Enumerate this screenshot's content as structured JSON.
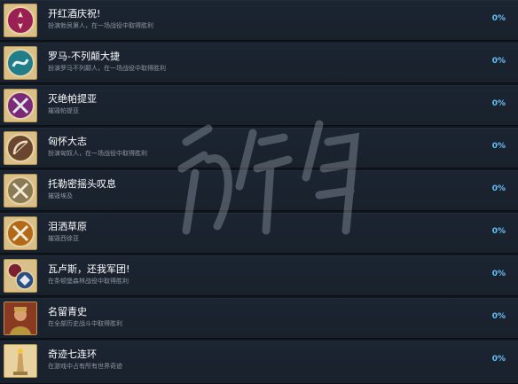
{
  "achievements": [
    {
      "title": "开红酒庆祝!",
      "desc": "扮演勃艮第人，在一场战役中取得胜利",
      "percent": "0%",
      "icon": "burgundian-tree-icon",
      "color": "#9a1f55"
    },
    {
      "title": "罗马-不列颠大捷",
      "desc": "扮演罗马不列颠人，在一场战役中取得胜利",
      "percent": "0%",
      "icon": "romano-british-dragon-icon",
      "color": "#1f7e8a"
    },
    {
      "title": "灭绝帕提亚",
      "desc": "摧毁帕提亚",
      "percent": "0%",
      "icon": "crossed-swords-icon",
      "color": "#7a2a7a"
    },
    {
      "title": "匈怀大志",
      "desc": "扮演匈奴人，在一场战役中取得胜利",
      "percent": "0%",
      "icon": "hun-bow-icon",
      "color": "#6a4530"
    },
    {
      "title": "托勒密摇头叹息",
      "desc": "摧毁埃及",
      "percent": "0%",
      "icon": "crossed-swords-icon",
      "color": "#8a7a55"
    },
    {
      "title": "泪洒草原",
      "desc": "摧毁西徐亚",
      "percent": "0%",
      "icon": "crossed-swords-icon",
      "color": "#b26a1a"
    },
    {
      "title": "瓦卢斯，还我军团!",
      "desc": "在条顿堡森林战役中取得胜利",
      "percent": "0%",
      "icon": "legion-eagle-icon",
      "color": "#7a2030"
    },
    {
      "title": "名留青史",
      "desc": "在全部历史战斗中取得胜利",
      "percent": "0%",
      "icon": "historical-general-portrait-icon",
      "color": "#8a3a22"
    },
    {
      "title": "奇迹七连环",
      "desc": "在游戏中占有所有世界奇迹",
      "percent": "0%",
      "icon": "wonder-pharos-icon",
      "color": "#c8a060"
    }
  ],
  "watermark": {
    "text": "游侠网"
  }
}
